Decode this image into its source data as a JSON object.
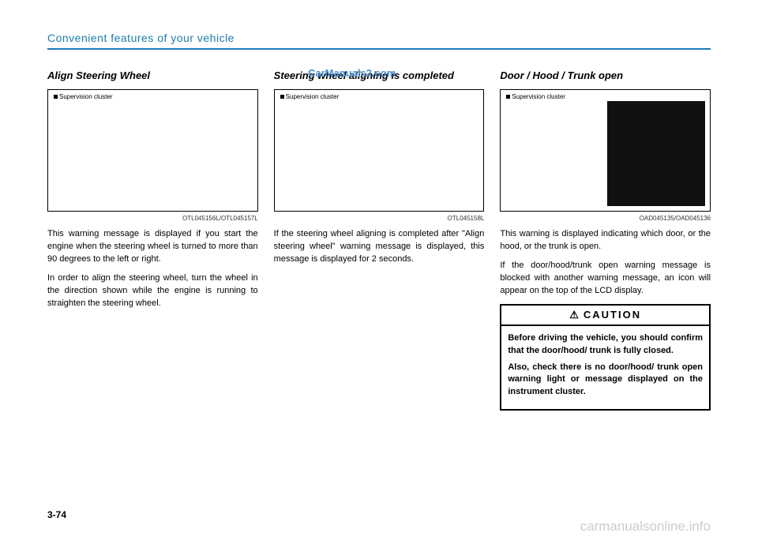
{
  "header": "Convenient features of your vehicle",
  "watermark_top": "CarManuals2.com",
  "watermark_bottom": "carmanualsonline.info",
  "page_num": "3-74",
  "col1": {
    "title": "Align Steering Wheel",
    "fig_label": "Supervision cluster",
    "fig_code": "OTL045156L/OTL045157L",
    "p1": "This warning message is displayed if you start the engine when the steering wheel is turned to more than 90 degrees to the left or right.",
    "p2": "In order to align the steering wheel, turn the wheel in the direction shown while the engine is running to straighten the steering wheel."
  },
  "col2": {
    "title": "Steering wheel aligning is completed",
    "fig_label": "Supervision cluster",
    "fig_code": "OTL045158L",
    "p1": "If the steering wheel aligning is completed after \"Align steering wheel\" warning message is displayed, this message is displayed for 2 seconds."
  },
  "col3": {
    "title": "Door / Hood / Trunk open",
    "fig_label": "Supervision cluster",
    "fig_code": "OAD045135/OAD045136",
    "p1": "This warning is displayed indicating which door, or the hood, or the trunk is open.",
    "p2": "If the door/hood/trunk open warning message is blocked with another warning message, an icon will appear on the top of the LCD display.",
    "caution_header": "CAUTION",
    "caution_p1": "Before driving the vehicle, you should confirm that the door/hood/ trunk is fully closed.",
    "caution_p2": "Also, check there is no door/hood/ trunk open warning light or message displayed on the instrument cluster."
  }
}
